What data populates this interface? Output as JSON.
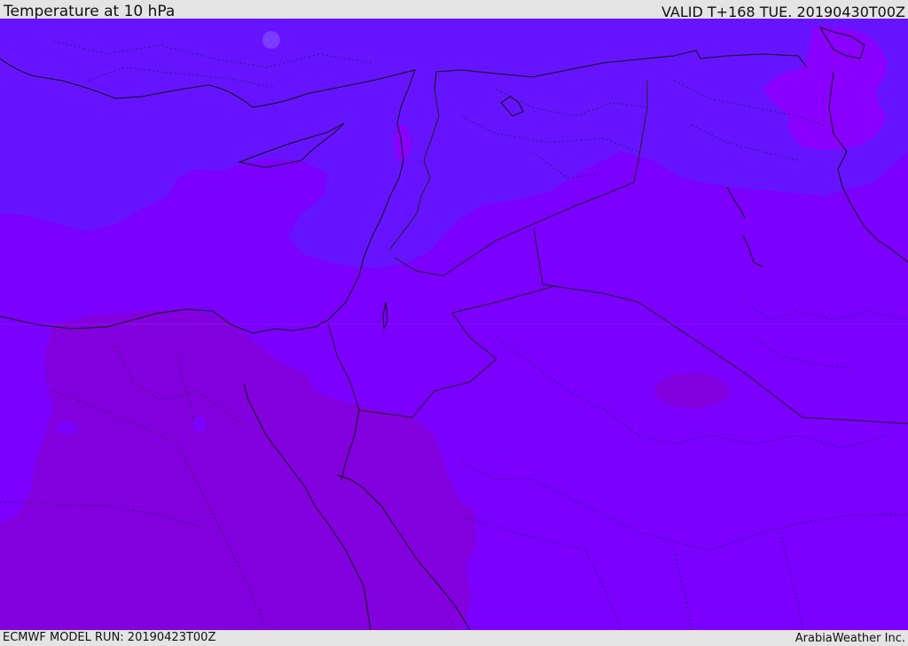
{
  "header": {
    "title": "Temperature at 10 hPa",
    "valid_time": "VALID T+168 TUE. 20190430T00Z"
  },
  "footer": {
    "model_run": "ECMWF MODEL RUN: 20190423T00Z",
    "credit": "ArabiaWeather Inc."
  },
  "map": {
    "region": "Eastern Mediterranean, Middle East and Egypt",
    "colors": {
      "background_fill": "#7b00ff",
      "cold_band_fill": "#6614ff",
      "warm_band_fill": "#8300de",
      "spot_light": "#7a3cff",
      "spot_magenta": "#8a00ff",
      "coastline": "#111111",
      "border": "#222222"
    }
  }
}
